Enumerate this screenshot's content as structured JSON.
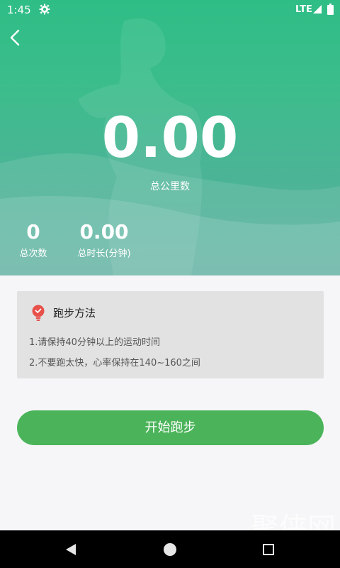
{
  "status_bar": {
    "time": "1:45",
    "network": "LTE",
    "icons": [
      "settings-gear-icon",
      "signal-icon",
      "battery-icon"
    ]
  },
  "header": {
    "back_icon": "chevron-left-icon",
    "total_km_value": "0.00",
    "total_km_label": "总公里数"
  },
  "stats": {
    "count_value": "0",
    "count_label": "总次数",
    "duration_value": "0.00",
    "duration_label": "总时长(分钟)"
  },
  "method": {
    "icon": "lightbulb-icon",
    "title": "跑步方法",
    "lines": [
      "1.请保持40分钟以上的运动时间",
      "2.不要跑太快，心率保持在140~160之间"
    ]
  },
  "actions": {
    "start_label": "开始跑步"
  },
  "nav": {
    "icons": [
      "nav-back-icon",
      "nav-home-icon",
      "nav-recents-icon"
    ]
  },
  "watermark": {
    "text": "聚侠网",
    "url": "www.juxia.com"
  },
  "colors": {
    "hero_green": "#2fbd86",
    "button_green": "#4bb45a",
    "card_gray": "#e2e2e2",
    "tip_icon_red": "#e8504a"
  }
}
